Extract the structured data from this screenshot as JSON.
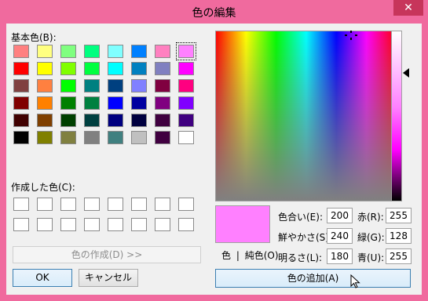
{
  "window": {
    "title": "色の編集",
    "close_glyph": "✕"
  },
  "basic": {
    "label": "基本色(B):",
    "colors": [
      "#ff8080",
      "#ffff80",
      "#80ff80",
      "#00ff80",
      "#80ffff",
      "#0080ff",
      "#ff80c0",
      "#ff80ff",
      "#ff0000",
      "#ffff00",
      "#80ff00",
      "#00ff40",
      "#00ffff",
      "#0080c0",
      "#8080c0",
      "#ff00ff",
      "#804040",
      "#ff8040",
      "#00ff00",
      "#008080",
      "#004080",
      "#8080ff",
      "#800040",
      "#ff0080",
      "#800000",
      "#ff8000",
      "#008000",
      "#008040",
      "#0000ff",
      "#0000a0",
      "#800080",
      "#8000ff",
      "#400000",
      "#804000",
      "#004000",
      "#004040",
      "#000080",
      "#000040",
      "#400040",
      "#400080",
      "#000000",
      "#808000",
      "#808040",
      "#808080",
      "#408080",
      "#c0c0c0",
      "#400040",
      "#ffffff"
    ],
    "selected_index": 7
  },
  "custom": {
    "label": "作成した色(C):",
    "count": 16
  },
  "buttons": {
    "define": "色の作成(D) >>",
    "ok": "OK",
    "cancel": "キャンセル",
    "add": "色の追加(A)"
  },
  "solid": {
    "color_label": "色",
    "separator": "|",
    "solid_label": "純色(O)"
  },
  "fields": {
    "hue": {
      "label": "色合い(E):",
      "value": "200"
    },
    "sat": {
      "label": "鮮やかさ(S):",
      "value": "240"
    },
    "lum": {
      "label": "明るさ(L):",
      "value": "180"
    },
    "red": {
      "label": "赤(R):",
      "value": "255"
    },
    "green": {
      "label": "緑(G):",
      "value": "128"
    },
    "blue": {
      "label": "青(U):",
      "value": "255"
    }
  },
  "current_color": "#ff80ff"
}
